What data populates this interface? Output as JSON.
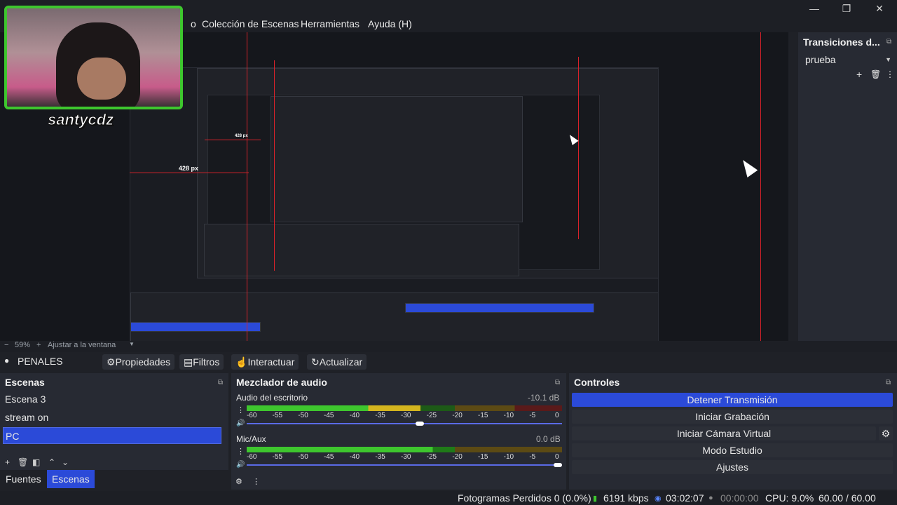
{
  "menu": {
    "items": [
      "Colección de Escenas",
      "Herramientas",
      "Ayuda (H)"
    ],
    "partial": "o"
  },
  "webcam": {
    "name": "santycdz"
  },
  "preview": {
    "measure_label": "428 px",
    "measure_label_small": "428 px"
  },
  "transitions": {
    "title": "Transiciones d...",
    "selected": "prueba"
  },
  "toolbar": {
    "zoom": "59%",
    "fit": "Ajustar a la ventana"
  },
  "source_bar": {
    "scene_name": "PENALES",
    "properties": "Propiedades",
    "filters": "Filtros",
    "interact": "Interactuar",
    "refresh": "Actualizar"
  },
  "scenes": {
    "title": "Escenas",
    "items": [
      "Escena 3",
      "stream on",
      "PC"
    ],
    "selected_index": 2,
    "tabs": [
      "Fuentes",
      "Escenas"
    ]
  },
  "mixer": {
    "title": "Mezclador de audio",
    "channels": [
      {
        "name": "Audio del escritorio",
        "db": "-10.1 dB",
        "level": 0.55
      },
      {
        "name": "Mic/Aux",
        "db": "0.0 dB",
        "level": 1.0
      }
    ],
    "scale": [
      "-60",
      "-55",
      "-50",
      "-45",
      "-40",
      "-35",
      "-30",
      "-25",
      "-20",
      "-15",
      "-10",
      "-5",
      "0"
    ]
  },
  "controls": {
    "title": "Controles",
    "buttons": [
      "Detener Transmisión",
      "Iniciar Grabación",
      "Iniciar Cámara Virtual",
      "Modo Estudio",
      "Ajustes"
    ]
  },
  "status": {
    "dropped": "Fotogramas Perdidos 0 (0.0%)",
    "bitrate": "6191 kbps",
    "stream_time": "03:02:07",
    "rec_time": "00:00:00",
    "cpu": "CPU: 9.0%",
    "fps": "60.00 / 60.00 FPS"
  },
  "colors": {
    "accent": "#2b4ad8",
    "red_guide": "#d9222a",
    "meter_green": "#3ec62e"
  }
}
